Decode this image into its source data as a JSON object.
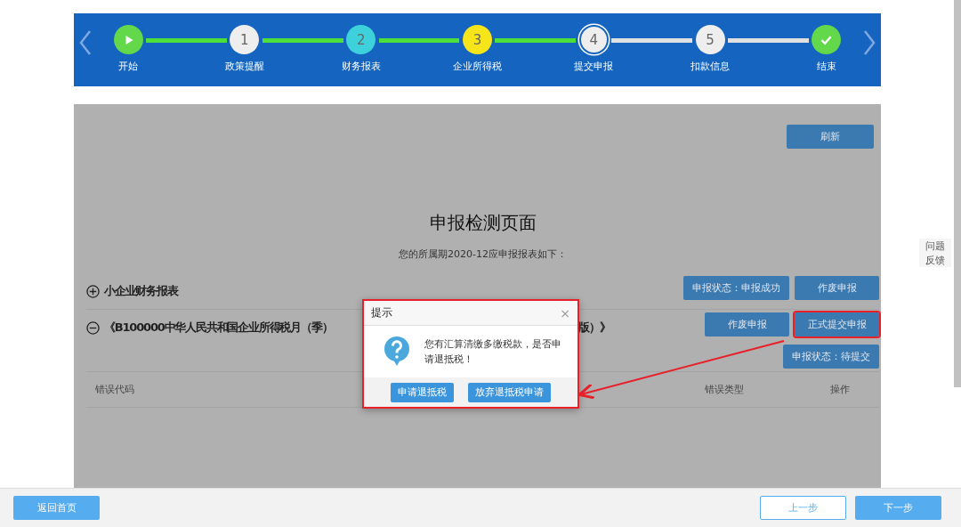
{
  "steps": [
    {
      "kind": "start",
      "label": "开始",
      "color": "#62d84a",
      "current": false
    },
    {
      "kind": "number",
      "number": "1",
      "label": "政策提醒",
      "color": "#eeeeee",
      "reached": true,
      "current": false
    },
    {
      "kind": "number",
      "number": "2",
      "label": "财务报表",
      "color": "#3dd1dc",
      "reached": true,
      "current": false
    },
    {
      "kind": "number",
      "number": "3",
      "label": "企业所得税",
      "color": "#f6e51a",
      "reached": true,
      "current": false
    },
    {
      "kind": "number",
      "number": "4",
      "label": "提交申报",
      "color": "#eeeeee",
      "reached": true,
      "current": true
    },
    {
      "kind": "number",
      "number": "5",
      "label": "扣款信息",
      "color": "#eeeeee",
      "reached": false,
      "current": false
    },
    {
      "kind": "end",
      "label": "结束",
      "color": "#62d84a",
      "reached": false,
      "current": false
    }
  ],
  "refresh_button": "刷新",
  "page_title": "申报检测页面",
  "subtitle": "您的所属期2020-12应申报报表如下：",
  "reports": [
    {
      "expanded": false,
      "title": "小企业财务报表",
      "buttons": [
        {
          "label": "申报状态：申报成功",
          "highlighted": false
        },
        {
          "label": "作废申报",
          "highlighted": false
        }
      ]
    },
    {
      "expanded": true,
      "title": "《B100000中华人民共和国企业所得税月（季）",
      "title_tail": "版）》",
      "buttons": [
        {
          "label": "作废申报",
          "highlighted": false
        },
        {
          "label": "正式提交申报",
          "highlighted": true
        }
      ],
      "status": "申报状态：待提交"
    }
  ],
  "table": {
    "columns": [
      "错误代码",
      "错误类型",
      "操作"
    ]
  },
  "dialog": {
    "title": "提示",
    "close": "×",
    "message": "您有汇算清缴多缴税款，是否申请退抵税！",
    "buttons": [
      "申请退抵税",
      "放弃退抵税申请"
    ]
  },
  "feedback": "问题反馈",
  "footer": {
    "home": "返回首页",
    "prev": "上一步",
    "next": "下一步"
  }
}
